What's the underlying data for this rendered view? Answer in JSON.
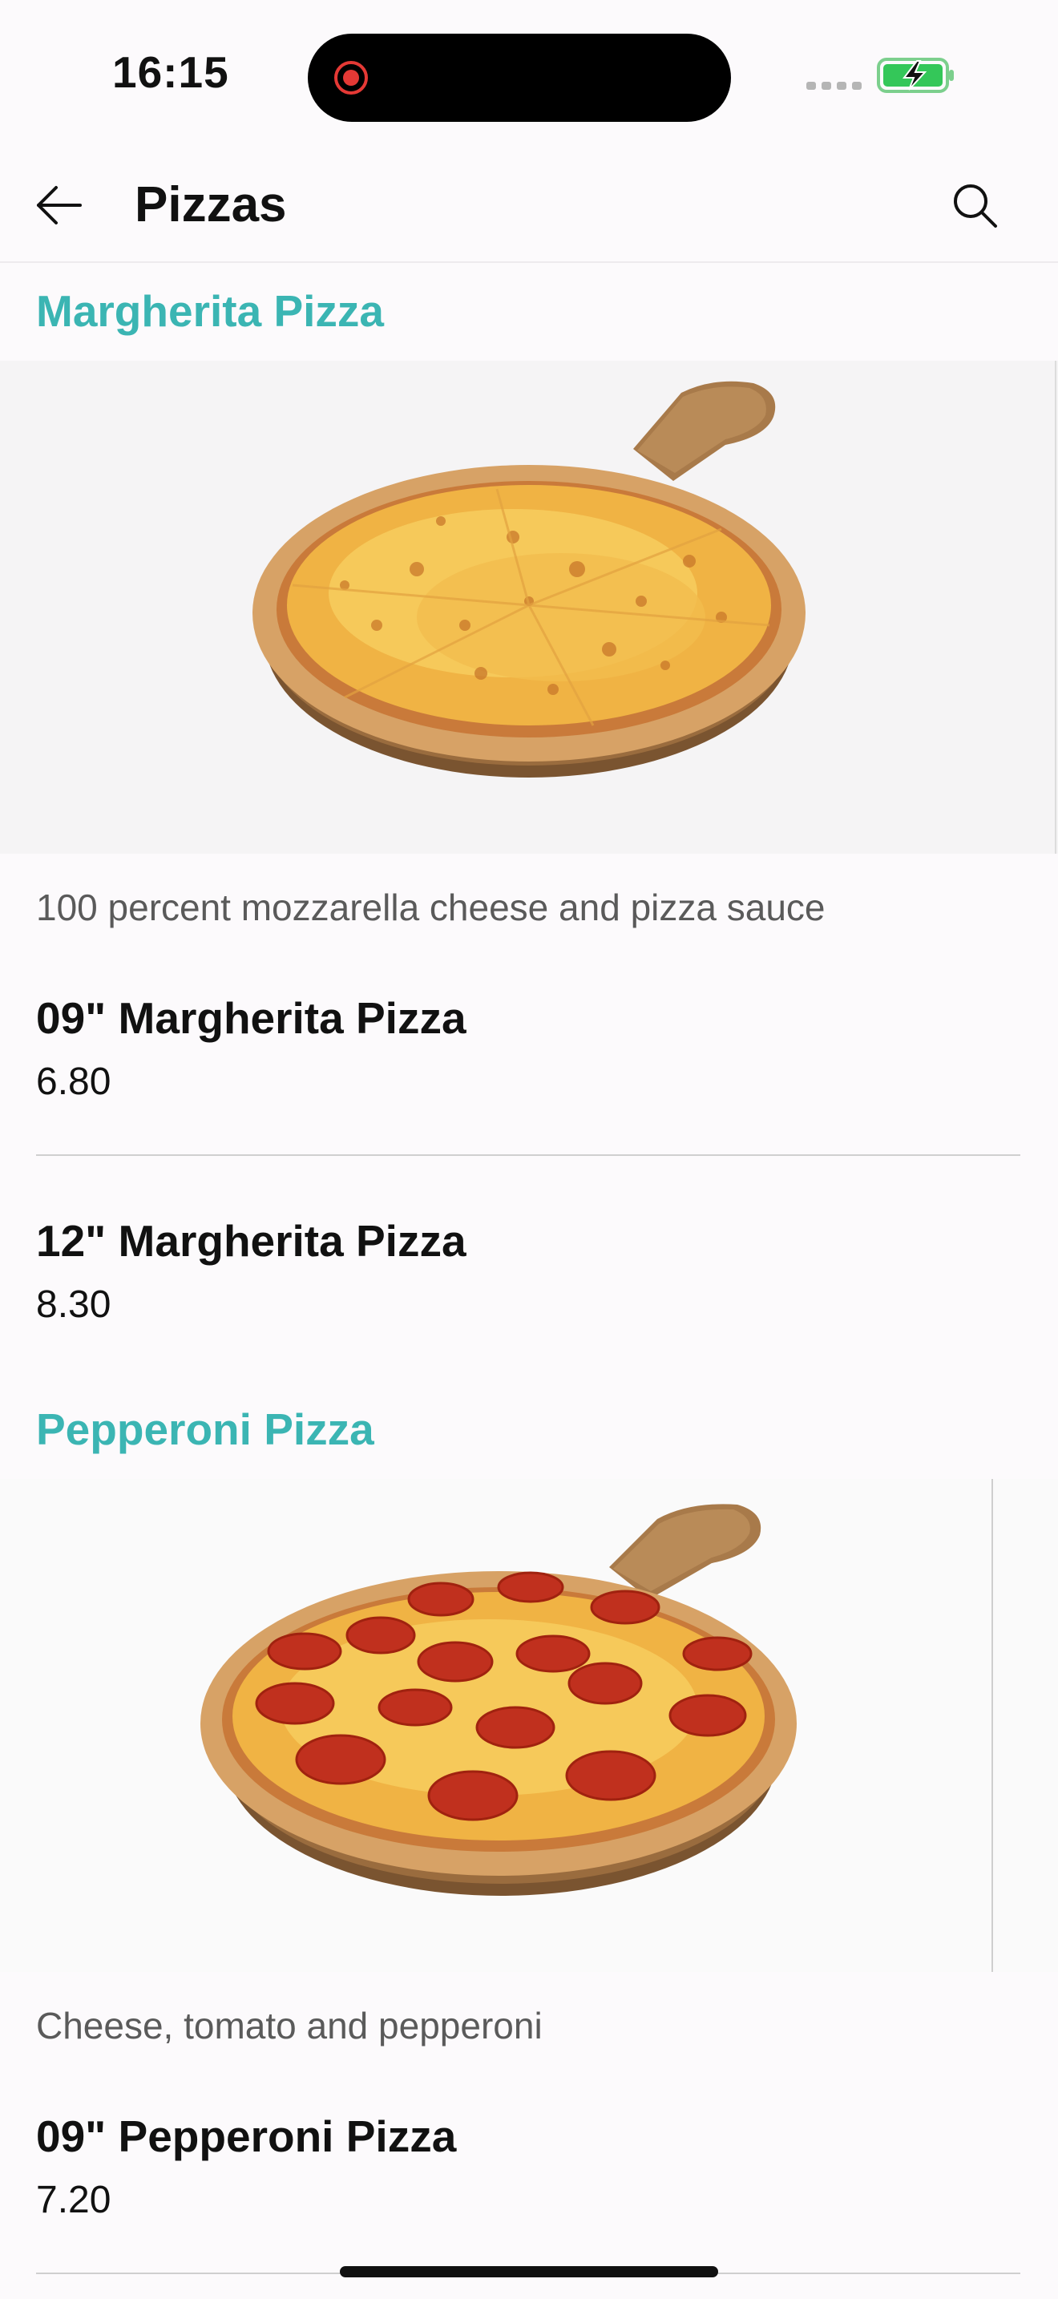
{
  "status_bar": {
    "time": "16:15"
  },
  "header": {
    "title": "Pizzas"
  },
  "sections": [
    {
      "title": "Margherita Pizza",
      "description": "100 percent mozzarella cheese and pizza sauce",
      "items": [
        {
          "name": "09\" Margherita Pizza",
          "price": "6.80"
        },
        {
          "name": "12\" Margherita Pizza",
          "price": "8.30"
        }
      ]
    },
    {
      "title": "Pepperoni Pizza",
      "description": "Cheese, tomato and pepperoni",
      "items": [
        {
          "name": "09\" Pepperoni Pizza",
          "price": "7.20"
        }
      ]
    }
  ],
  "colors": {
    "accent": "#3bb5b3",
    "battery": "#34c759",
    "record": "#e53935"
  }
}
